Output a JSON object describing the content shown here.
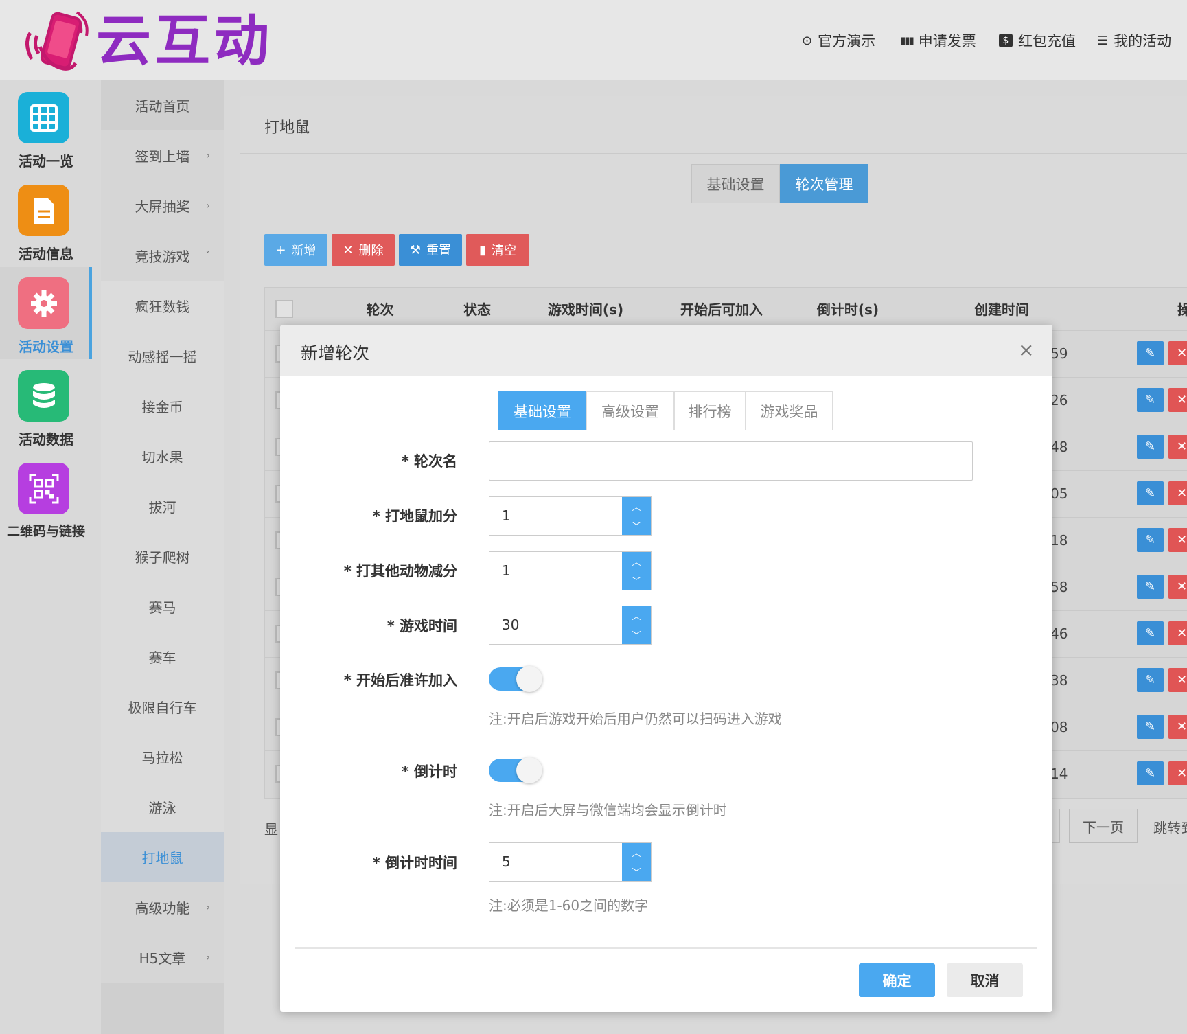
{
  "brand": {
    "name": "云互动",
    "accent": "#8e2bc0",
    "logo_icon": "phone-hand-icon"
  },
  "header_nav": [
    {
      "label": "官方演示",
      "icon": "play-circle-icon"
    },
    {
      "label": "申请发票",
      "icon": "barcode-icon"
    },
    {
      "label": "红包充值",
      "icon": "dollar-icon"
    },
    {
      "label": "我的活动",
      "icon": "list-icon"
    }
  ],
  "rail": [
    {
      "label": "活动一览",
      "icon": "grid-icon",
      "color": "#1ab0d8"
    },
    {
      "label": "活动信息",
      "icon": "document-icon",
      "color": "#ee8e14"
    },
    {
      "label": "活动设置",
      "icon": "gear-icon",
      "color": "#ef6f81",
      "active": true
    },
    {
      "label": "活动数据",
      "icon": "database-icon",
      "color": "#27ba77"
    },
    {
      "label": "二维码与链接",
      "icon": "qrcode-icon",
      "color": "#b63ee0"
    }
  ],
  "subnav": [
    {
      "label": "活动首页"
    },
    {
      "label": "签到上墙",
      "arrow": "›"
    },
    {
      "label": "大屏抽奖",
      "arrow": "›"
    },
    {
      "label": "竞技游戏",
      "arrow": "ˇ"
    },
    {
      "label": "疯狂数钱"
    },
    {
      "label": "动感摇一摇"
    },
    {
      "label": "接金币"
    },
    {
      "label": "切水果"
    },
    {
      "label": "拔河"
    },
    {
      "label": "猴子爬树"
    },
    {
      "label": "赛马"
    },
    {
      "label": "赛车"
    },
    {
      "label": "极限自行车"
    },
    {
      "label": "马拉松"
    },
    {
      "label": "游泳"
    },
    {
      "label": "打地鼠",
      "active": true
    },
    {
      "label": "高级功能",
      "arrow": "›"
    },
    {
      "label": "H5文章",
      "arrow": "›"
    }
  ],
  "page": {
    "title": "打地鼠",
    "segment": [
      "基础设置",
      "轮次管理"
    ],
    "toolbar": [
      {
        "label": "新增",
        "icon": "plus-icon",
        "color": "#5aa9e6"
      },
      {
        "label": "删除",
        "icon": "x-icon",
        "color": "#e05a5a"
      },
      {
        "label": "重置",
        "icon": "gavel-icon",
        "color": "#3a8fd6"
      },
      {
        "label": "清空",
        "icon": "trash-icon",
        "color": "#e05a5a"
      }
    ],
    "table_headers": [
      "轮次",
      "状态",
      "游戏时间(s)",
      "开始后可加入",
      "倒计时(s)",
      "创建时间",
      "操"
    ],
    "create_time_tails": [
      "59",
      "26",
      "48",
      "05",
      "18",
      "58",
      "46",
      "38",
      "08",
      "14"
    ],
    "pagination": {
      "left_text": "显",
      "next": "下一页",
      "jump": "跳转到"
    }
  },
  "dialog": {
    "title": "新增轮次",
    "close": "×",
    "tabs": [
      "基础设置",
      "高级设置",
      "排行榜",
      "游戏奖品"
    ],
    "fields": {
      "round_name": {
        "label": "* 轮次名",
        "value": ""
      },
      "hit_score": {
        "label": "* 打地鼠加分",
        "value": "1"
      },
      "other_penalty": {
        "label": "* 打其他动物减分",
        "value": "1"
      },
      "game_time": {
        "label": "* 游戏时间",
        "value": "30"
      },
      "allow_join": {
        "label": "* 开始后准许加入",
        "on": true,
        "note": "注:开启后游戏开始后用户仍然可以扫码进入游戏"
      },
      "countdown": {
        "label": "* 倒计时",
        "on": true,
        "note": "注:开启后大屏与微信端均会显示倒计时"
      },
      "countdown_time": {
        "label": "* 倒计时时间",
        "value": "5",
        "note": "注:必须是1-60之间的数字"
      }
    },
    "confirm": "确定",
    "cancel": "取消"
  }
}
